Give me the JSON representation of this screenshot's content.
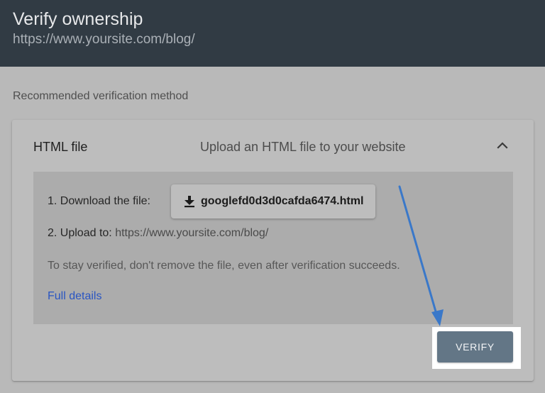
{
  "header": {
    "title": "Verify ownership",
    "url": "https://www.yoursite.com/blog/"
  },
  "section_label": "Recommended verification method",
  "method": {
    "title": "HTML file",
    "description": "Upload an HTML file to your website",
    "expanded_icon": "chevron-up-icon",
    "step1_label": "1. Download the file:",
    "download_filename": "googlefd0d3d0cafda6474.html",
    "download_icon": "download-icon",
    "step2_label": "2. Upload to:",
    "step2_url": "https://www.yoursite.com/blog/",
    "note": "To stay verified, don't remove the file, even after verification succeeds.",
    "details_link": "Full details"
  },
  "verify_button": "VERIFY",
  "colors": {
    "header_bg": "#313b44",
    "page_bg": "#b9b9b9",
    "link": "#2a55c2",
    "verify_bg": "#637686",
    "annotation_arrow": "#3a78c9"
  }
}
